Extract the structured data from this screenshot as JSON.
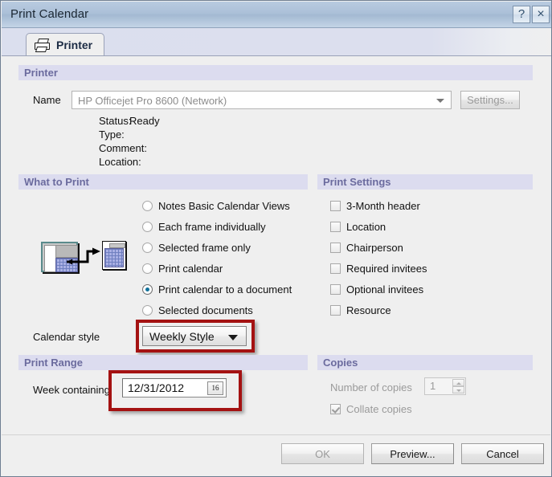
{
  "window": {
    "title": "Print Calendar",
    "help_button": "?",
    "close_button": "×"
  },
  "tabs": [
    {
      "label": "Printer",
      "icon": "printer-icon",
      "selected": true
    }
  ],
  "printer_section": {
    "header": "Printer",
    "name_label": "Name",
    "name_value": "HP Officejet Pro 8600 (Network)",
    "settings_button": "Settings...",
    "status_label": "Status:",
    "status_value": "Ready",
    "type_label": "Type:",
    "type_value": "",
    "comment_label": "Comment:",
    "comment_value": "",
    "location_label": "Location:",
    "location_value": ""
  },
  "what_to_print": {
    "header": "What to Print",
    "options": [
      {
        "label": "Notes Basic Calendar Views",
        "selected": false
      },
      {
        "label": "Each frame individually",
        "selected": false
      },
      {
        "label": "Selected frame only",
        "selected": false
      },
      {
        "label": "Print calendar",
        "selected": false
      },
      {
        "label": "Print calendar to a document",
        "selected": true
      },
      {
        "label": "Selected documents",
        "selected": false
      }
    ],
    "calendar_style_label": "Calendar style",
    "calendar_style_value": "Weekly Style"
  },
  "print_settings": {
    "header": "Print Settings",
    "options": [
      {
        "label": "3-Month header",
        "checked": false
      },
      {
        "label": "Location",
        "checked": false
      },
      {
        "label": "Chairperson",
        "checked": false
      },
      {
        "label": "Required invitees",
        "checked": false
      },
      {
        "label": "Optional invitees",
        "checked": false
      },
      {
        "label": "Resource",
        "checked": false
      }
    ]
  },
  "print_range": {
    "header": "Print Range",
    "week_label": "Week containing",
    "week_value": "12/31/2012",
    "calendar_button": "16"
  },
  "copies": {
    "header": "Copies",
    "number_label": "Number of copies",
    "number_value": "1",
    "collate_label": "Collate copies",
    "collate_checked": true
  },
  "footer": {
    "ok_button": "OK",
    "preview_button": "Preview...",
    "cancel_button": "Cancel"
  },
  "colors": {
    "titlebar": "#abc0d8",
    "section_header_bg": "#dcdcef",
    "section_header_text": "#6b6b9e",
    "dialog_bg": "#efefef",
    "annotation_red": "#a41212",
    "radio_dot": "#10719b"
  }
}
